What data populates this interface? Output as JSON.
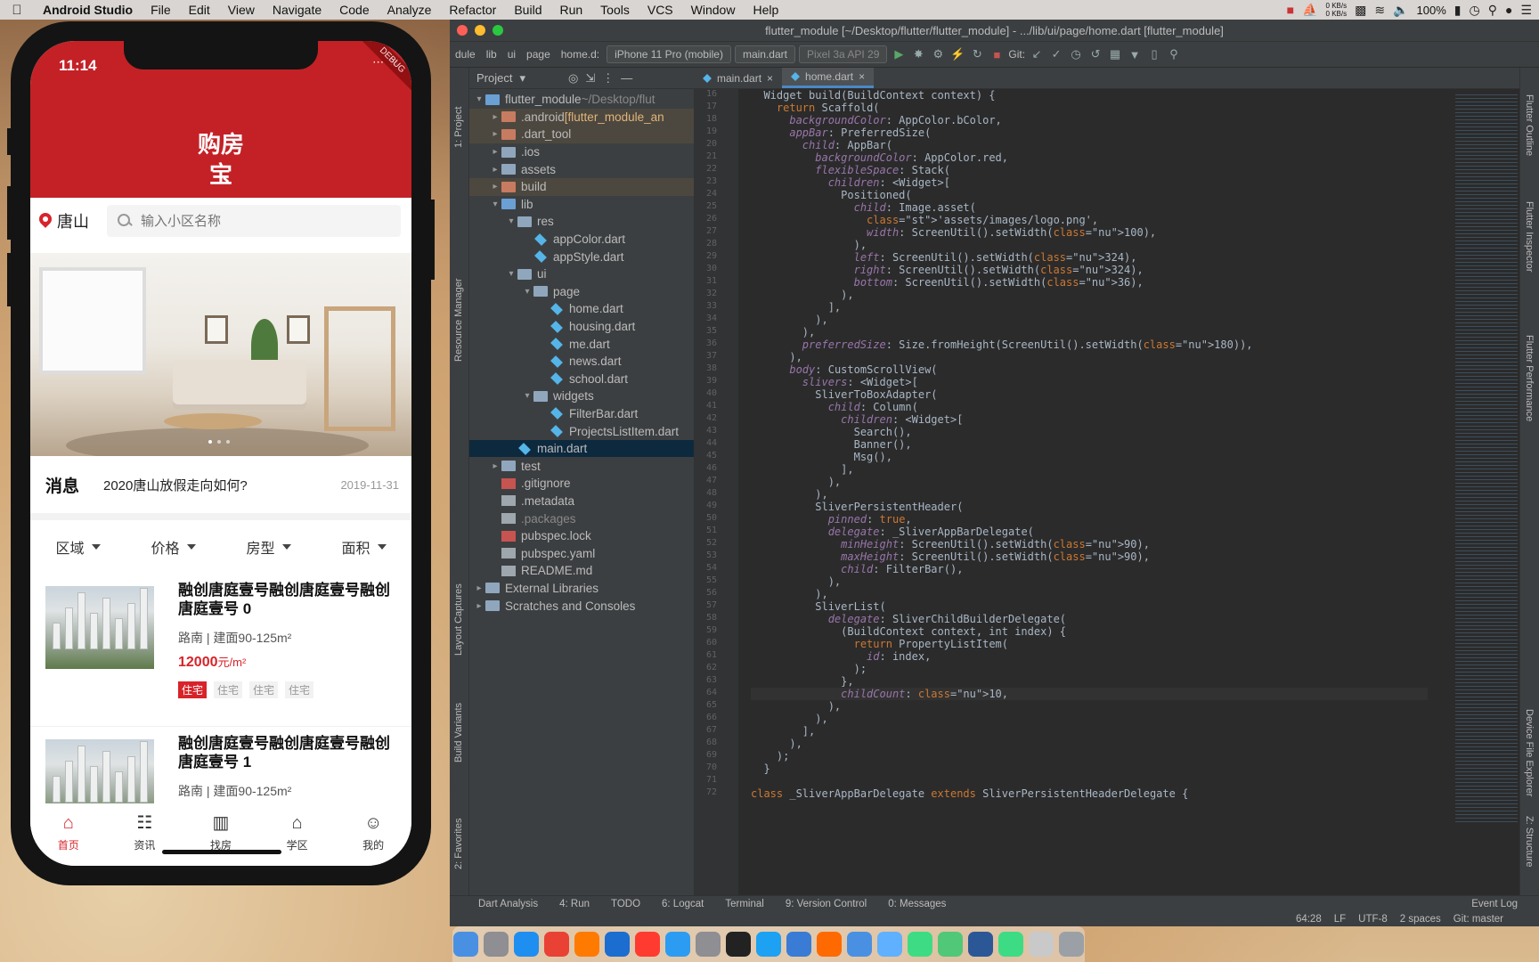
{
  "menubar": {
    "app": "Android Studio",
    "items": [
      "File",
      "Edit",
      "View",
      "Navigate",
      "Code",
      "Analyze",
      "Refactor",
      "Build",
      "Run",
      "Tools",
      "VCS",
      "Window",
      "Help"
    ],
    "net_up": "0 KB/s",
    "net_down": "0 KB/s",
    "battery": "100%"
  },
  "phone": {
    "time": "11:14",
    "debug_banner": "DEBUG",
    "city": "唐山",
    "search_placeholder": "输入小区名称",
    "message": {
      "tag": "消息",
      "text": "2020唐山放假走向如何?",
      "date": "2019-11-31"
    },
    "filters": [
      "区域",
      "价格",
      "房型",
      "面积"
    ],
    "listings": [
      {
        "title": "融创唐庭壹号融创唐庭壹号融创唐庭壹号 0",
        "sub": "路南 | 建面90-125m²",
        "price": "12000",
        "unit": "元/m²",
        "tags": [
          "住宅",
          "住宅",
          "住宅",
          "住宅"
        ]
      },
      {
        "title": "融创唐庭壹号融创唐庭壹号融创唐庭壹号 1",
        "sub": "路南 | 建面90-125m²"
      }
    ],
    "tabs": [
      {
        "label": "首页",
        "icon": "home-icon"
      },
      {
        "label": "资讯",
        "icon": "news-icon"
      },
      {
        "label": "找房",
        "icon": "building-icon"
      },
      {
        "label": "学区",
        "icon": "graduation-cap-icon"
      },
      {
        "label": "我的",
        "icon": "smile-icon"
      }
    ],
    "active_color": "#d8232a",
    "appbar_color": "#c32126"
  },
  "ide": {
    "title": "flutter_module [~/Desktop/flutter/flutter_module] - .../lib/ui/page/home.dart [flutter_module]",
    "breadcrumbs": [
      "dule",
      "lib",
      "ui",
      "page",
      "home.d:"
    ],
    "device": "iPhone 11 Pro (mobile)",
    "run_config": "main.dart",
    "emulator": "Pixel 3a API 29",
    "git_label": "Git:",
    "project_label": "Project",
    "tabs": [
      "main.dart",
      "home.dart"
    ],
    "side_left": [
      "1: Project",
      "Resource Manager",
      "Layout Captures",
      "Build Variants",
      "2: Favorites"
    ],
    "side_right": [
      "Flutter Outline",
      "Flutter Inspector",
      "Flutter Performance",
      "Device File Explorer",
      "Z: Structure"
    ],
    "tree": [
      {
        "name": "flutter_module",
        "extra": "~/Desktop/flut",
        "kind": "folder-bl",
        "depth": 0,
        "arrow": "v"
      },
      {
        "name": ".android",
        "extra": "[flutter_module_an",
        "kind": "folder-ex",
        "depth": 1,
        "arrow": ">"
      },
      {
        "name": ".dart_tool",
        "kind": "folder-ex",
        "depth": 1,
        "arrow": ">"
      },
      {
        "name": ".ios",
        "kind": "folder",
        "depth": 1,
        "arrow": ">"
      },
      {
        "name": "assets",
        "kind": "folder",
        "depth": 1,
        "arrow": ">"
      },
      {
        "name": "build",
        "kind": "folder-ex",
        "depth": 1,
        "arrow": ">"
      },
      {
        "name": "lib",
        "kind": "folder-bl",
        "depth": 1,
        "arrow": "v"
      },
      {
        "name": "res",
        "kind": "folder",
        "depth": 2,
        "arrow": "v"
      },
      {
        "name": "appColor.dart",
        "kind": "dart",
        "depth": 3,
        "arrow": ""
      },
      {
        "name": "appStyle.dart",
        "kind": "dart",
        "depth": 3,
        "arrow": ""
      },
      {
        "name": "ui",
        "kind": "folder",
        "depth": 2,
        "arrow": "v"
      },
      {
        "name": "page",
        "kind": "folder",
        "depth": 3,
        "arrow": "v"
      },
      {
        "name": "home.dart",
        "kind": "dart",
        "depth": 4,
        "arrow": ""
      },
      {
        "name": "housing.dart",
        "kind": "dart",
        "depth": 4,
        "arrow": ""
      },
      {
        "name": "me.dart",
        "kind": "dart",
        "depth": 4,
        "arrow": ""
      },
      {
        "name": "news.dart",
        "kind": "dart",
        "depth": 4,
        "arrow": ""
      },
      {
        "name": "school.dart",
        "kind": "dart",
        "depth": 4,
        "arrow": ""
      },
      {
        "name": "widgets",
        "kind": "folder",
        "depth": 3,
        "arrow": "v"
      },
      {
        "name": "FilterBar.dart",
        "kind": "dart",
        "depth": 4,
        "arrow": ""
      },
      {
        "name": "ProjectsListItem.dart",
        "kind": "dart",
        "depth": 4,
        "arrow": ""
      },
      {
        "name": "main.dart",
        "kind": "dart",
        "depth": 2,
        "arrow": "",
        "selected": true
      },
      {
        "name": "test",
        "kind": "folder",
        "depth": 1,
        "arrow": ">"
      },
      {
        "name": ".gitignore",
        "kind": "lock",
        "depth": 1,
        "arrow": ""
      },
      {
        "name": ".metadata",
        "kind": "file",
        "depth": 1,
        "arrow": ""
      },
      {
        "name": ".packages",
        "kind": "file",
        "depth": 1,
        "arrow": "",
        "muted": true
      },
      {
        "name": "pubspec.lock",
        "kind": "lock",
        "depth": 1,
        "arrow": ""
      },
      {
        "name": "pubspec.yaml",
        "kind": "file",
        "depth": 1,
        "arrow": ""
      },
      {
        "name": "README.md",
        "kind": "file",
        "depth": 1,
        "arrow": ""
      },
      {
        "name": "External Libraries",
        "kind": "folder",
        "depth": 0,
        "arrow": ">"
      },
      {
        "name": "Scratches and Consoles",
        "kind": "folder",
        "depth": 0,
        "arrow": ">"
      }
    ],
    "code_start_line": 16,
    "code": [
      "  Widget build(BuildContext context) {",
      "    return Scaffold(",
      "      backgroundColor: AppColor.bColor,",
      "      appBar: PreferredSize(",
      "        child: AppBar(",
      "          backgroundColor: AppColor.red,",
      "          flexibleSpace: Stack(",
      "            children: <Widget>[",
      "              Positioned(",
      "                child: Image.asset(",
      "                  'assets/images/logo.png',",
      "                  width: ScreenUtil().setWidth(100),",
      "                ),",
      "                left: ScreenUtil().setWidth(324),",
      "                right: ScreenUtil().setWidth(324),",
      "                bottom: ScreenUtil().setWidth(36),",
      "              ),",
      "            ],",
      "          ),",
      "        ),",
      "        preferredSize: Size.fromHeight(ScreenUtil().setWidth(180)),",
      "      ),",
      "      body: CustomScrollView(",
      "        slivers: <Widget>[",
      "          SliverToBoxAdapter(",
      "            child: Column(",
      "              children: <Widget>[",
      "                Search(),",
      "                Banner(),",
      "                Msg(),",
      "              ],",
      "            ),",
      "          ),",
      "          SliverPersistentHeader(",
      "            pinned: true,",
      "            delegate: _SliverAppBarDelegate(",
      "              minHeight: ScreenUtil().setWidth(90),",
      "              maxHeight: ScreenUtil().setWidth(90),",
      "              child: FilterBar(),",
      "            ),",
      "          ),",
      "          SliverList(",
      "            delegate: SliverChildBuilderDelegate(",
      "              (BuildContext context, int index) {",
      "                return PropertyListItem(",
      "                  id: index,",
      "                );",
      "              },",
      "              childCount: 10,",
      "            ),",
      "          ),",
      "        ],",
      "      ),",
      "    );",
      "  }",
      "",
      "class _SliverAppBarDelegate extends SliverPersistentHeaderDelegate {"
    ],
    "status_tools": [
      "Dart Analysis",
      "4: Run",
      "TODO",
      "6: Logcat",
      "Terminal",
      "9: Version Control",
      "0: Messages"
    ],
    "event_log": "Event Log",
    "position": "64:28",
    "line_sep": "LF",
    "encoding": "UTF-8",
    "indent": "2 spaces",
    "branch": "Git: master"
  }
}
